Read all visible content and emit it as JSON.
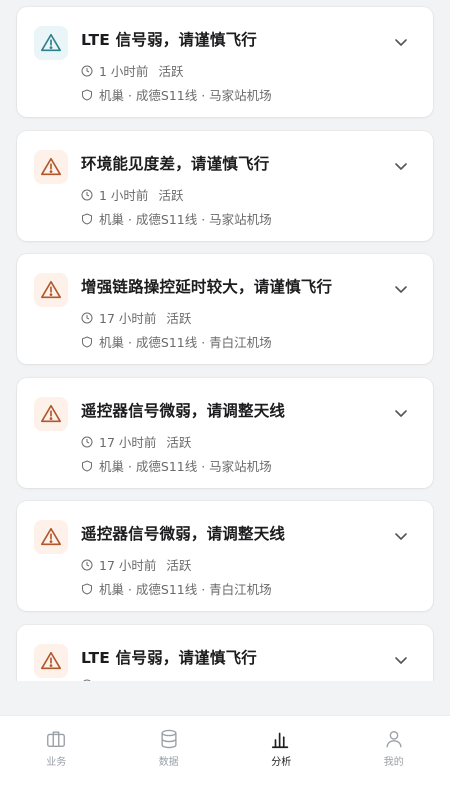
{
  "alerts": [
    {
      "title": "LTE 信号弱，请谨慎飞行",
      "time": "1 小时前",
      "status": "活跃",
      "location": "机巢 · 成德S11线 · 马家站机场",
      "icon": "warning-triangle-icon",
      "tone": "info"
    },
    {
      "title": "环境能见度差，请谨慎飞行",
      "time": "1 小时前",
      "status": "活跃",
      "location": "机巢 · 成德S11线 · 马家站机场",
      "icon": "warning-triangle-icon",
      "tone": "warn"
    },
    {
      "title": "增强链路操控延时较大，请谨慎飞行",
      "time": "17 小时前",
      "status": "活跃",
      "location": "机巢 · 成德S11线 · 青白江机场",
      "icon": "warning-triangle-icon",
      "tone": "warn"
    },
    {
      "title": "遥控器信号微弱，请调整天线",
      "time": "17 小时前",
      "status": "活跃",
      "location": "机巢 · 成德S11线 · 马家站机场",
      "icon": "warning-triangle-icon",
      "tone": "warn"
    },
    {
      "title": "遥控器信号微弱，请调整天线",
      "time": "17 小时前",
      "status": "活跃",
      "location": "机巢 · 成德S11线 · 青白江机场",
      "icon": "warning-triangle-icon",
      "tone": "warn"
    },
    {
      "title": "LTE 信号弱，请谨慎飞行",
      "time": "",
      "status": "",
      "location": "",
      "icon": "warning-triangle-icon",
      "tone": "warn"
    }
  ],
  "tabbar": {
    "items": [
      {
        "label": "业务",
        "icon": "briefcase-icon"
      },
      {
        "label": "数据",
        "icon": "database-icon"
      },
      {
        "label": "分析",
        "icon": "bar-chart-icon"
      },
      {
        "label": "我的",
        "icon": "user-icon"
      }
    ],
    "active_label": "分析"
  },
  "colors": {
    "warn": "#b0572c",
    "info": "#2f7f8e",
    "background": "#f2f3f5"
  }
}
